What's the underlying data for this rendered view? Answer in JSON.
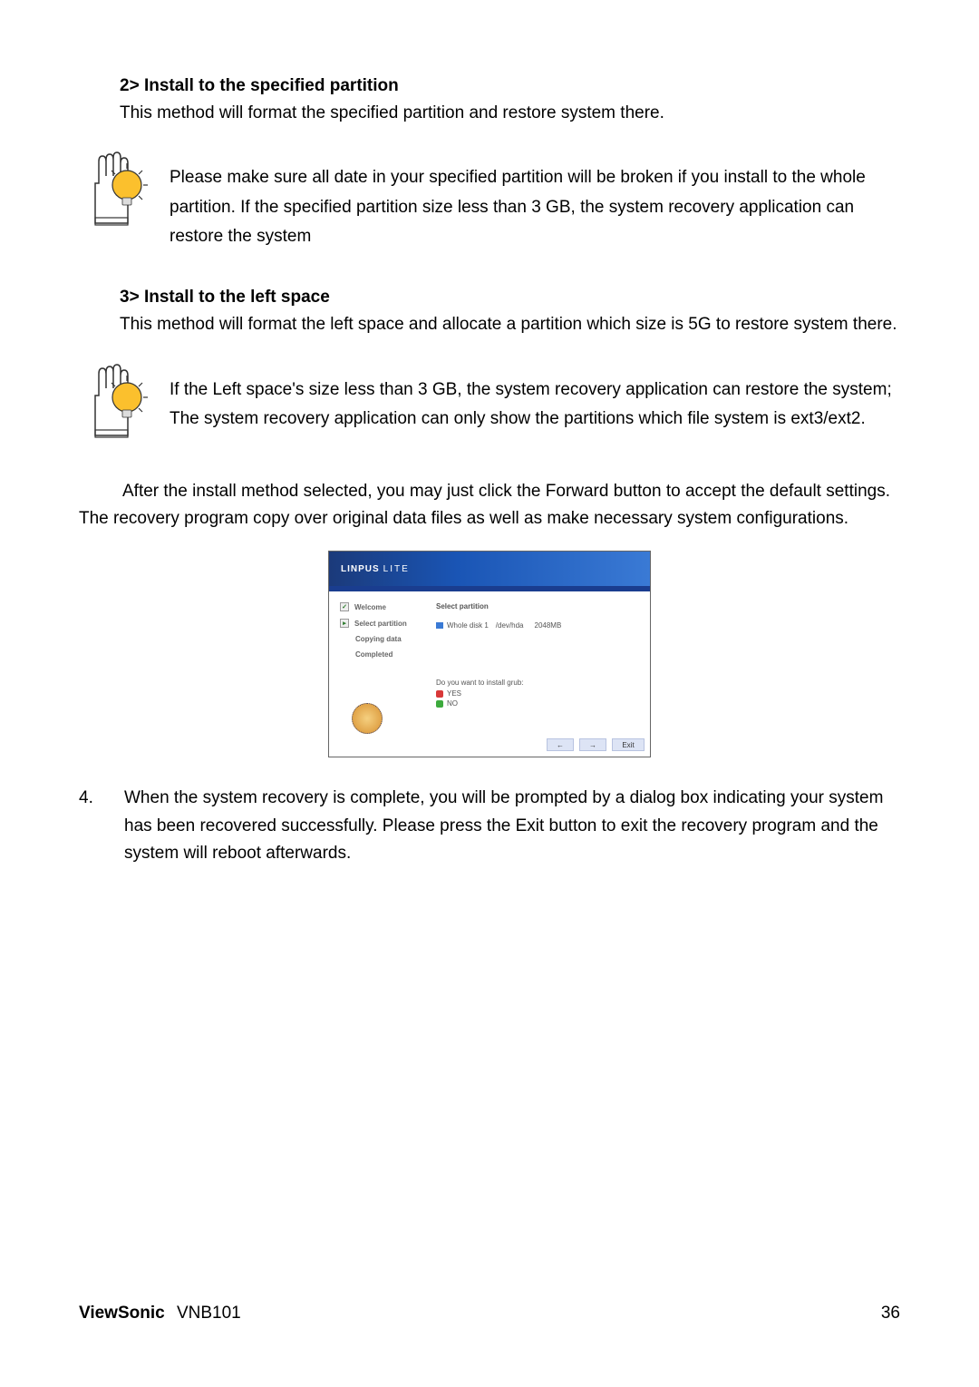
{
  "sections": {
    "s2": {
      "heading": "2> Install to the specified partition",
      "intro": "This method will format the specified partition and restore system there.",
      "callout": "Please make sure all date in your specified partition will be broken if you install to the whole partition. If the specified partition size less than 3 GB, the system recovery application can restore the system"
    },
    "s3": {
      "heading": "3> Install to the left space",
      "intro": "This method will format the left space and allocate a partition which size is 5G to restore system there.",
      "callout": "If the Left space's size less than 3 GB, the system recovery application can restore the system; The system recovery application can only show the partitions which file system is ext3/ext2."
    },
    "after": "After the install method selected, you may just click the Forward button to accept the default settings. The recovery program copy over original data files as well as make necessary system configurations.",
    "step4": {
      "num": "4.",
      "text": "When the system recovery is complete, you will be prompted by a dialog box indicating your system has been recovered successfully. Please press the Exit button to exit the recovery program and the system will reboot afterwards."
    }
  },
  "screenshot": {
    "brand": "LINPUS",
    "brand2": "LITE",
    "steps": {
      "welcome": "Welcome",
      "select": "Select partition",
      "copying": "Copying data",
      "completed": "Completed"
    },
    "main_title": "Select partition",
    "disk_label": "Whole disk 1",
    "disk_dev": "/dev/hda",
    "disk_size": "2048MB",
    "grub_q": "Do you want to install grub:",
    "yes": "YES",
    "no": "NO",
    "back": "←",
    "forward": "→",
    "exit": "Exit"
  },
  "footer": {
    "brand": "ViewSonic",
    "model": "VNB101",
    "page": "36"
  }
}
